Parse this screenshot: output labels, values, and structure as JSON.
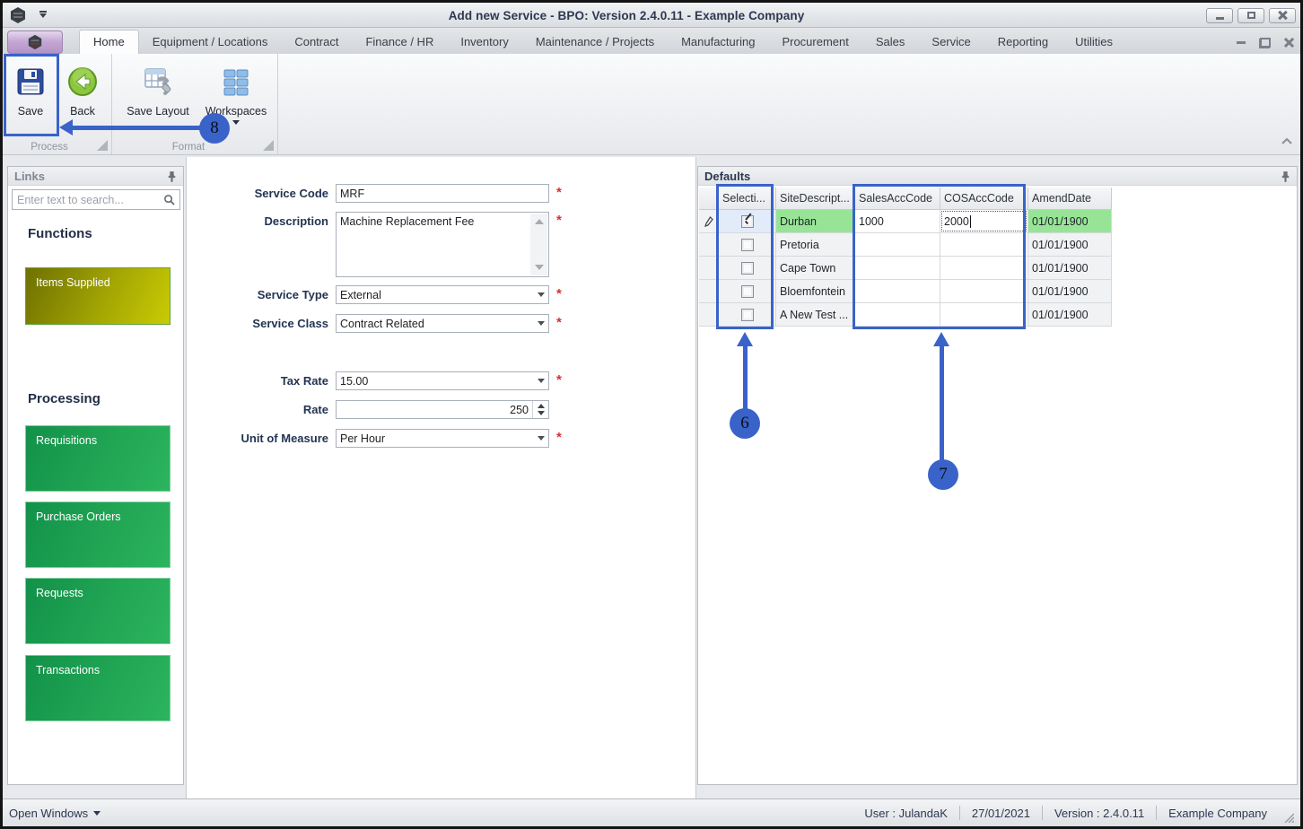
{
  "window": {
    "title": "Add new Service - BPO: Version 2.4.0.11 - Example Company"
  },
  "ribbon": {
    "tabs": [
      "Home",
      "Equipment / Locations",
      "Contract",
      "Finance / HR",
      "Inventory",
      "Maintenance / Projects",
      "Manufacturing",
      "Procurement",
      "Sales",
      "Service",
      "Reporting",
      "Utilities"
    ],
    "active_tab": "Home",
    "buttons": {
      "save": "Save",
      "back": "Back",
      "save_layout": "Save Layout",
      "workspaces": "Workspaces"
    },
    "groups": {
      "process": "Process",
      "format": "Format"
    }
  },
  "links_panel": {
    "title": "Links",
    "search_placeholder": "Enter text to search...",
    "functions_heading": "Functions",
    "functions_items": [
      {
        "label": "Items Supplied"
      }
    ],
    "processing_heading": "Processing",
    "processing_items": [
      {
        "label": "Requisitions"
      },
      {
        "label": "Purchase Orders"
      },
      {
        "label": "Requests"
      },
      {
        "label": "Transactions"
      }
    ]
  },
  "form": {
    "required_marker": "*",
    "fields": [
      {
        "label": "Service Code",
        "value": "MRF",
        "type": "text",
        "required": true
      },
      {
        "label": "Description",
        "value": "Machine Replacement Fee",
        "type": "textarea",
        "required": true
      },
      {
        "label": "Service Type",
        "value": "External",
        "type": "dropdown",
        "required": true
      },
      {
        "label": "Service Class",
        "value": "Contract Related",
        "type": "dropdown",
        "required": true
      },
      {
        "label": "Tax Rate",
        "value": "15.00",
        "type": "dropdown",
        "required": true
      },
      {
        "label": "Rate",
        "value": "250",
        "type": "spinner",
        "required": false
      },
      {
        "label": "Unit of Measure",
        "value": "Per Hour",
        "type": "dropdown",
        "required": true
      }
    ]
  },
  "defaults_panel": {
    "title": "Defaults",
    "columns": [
      "Selecti...",
      "SiteDescript...",
      "SalesAccCode",
      "COSAccCode",
      "AmendDate"
    ],
    "rows": [
      {
        "selected": true,
        "site": "Durban",
        "sales_acc_code": "1000",
        "cos_acc_code": "2000",
        "amend_date": "01/01/1900"
      },
      {
        "selected": false,
        "site": "Pretoria",
        "sales_acc_code": "",
        "cos_acc_code": "",
        "amend_date": "01/01/1900"
      },
      {
        "selected": false,
        "site": "Cape Town",
        "sales_acc_code": "",
        "cos_acc_code": "",
        "amend_date": "01/01/1900"
      },
      {
        "selected": false,
        "site": "Bloemfontein",
        "sales_acc_code": "",
        "cos_acc_code": "",
        "amend_date": "01/01/1900"
      },
      {
        "selected": false,
        "site": "A New Test ...",
        "sales_acc_code": "",
        "cos_acc_code": "",
        "amend_date": "01/01/1900"
      }
    ]
  },
  "statusbar": {
    "open_windows": "Open Windows",
    "user": "User : JulandaK",
    "date": "27/01/2021",
    "version": "Version : 2.4.0.11",
    "company": "Example Company"
  },
  "annotations": {
    "accent_color": "#3a63c9",
    "callout_6": "6",
    "callout_7": "7",
    "callout_8": "8"
  }
}
